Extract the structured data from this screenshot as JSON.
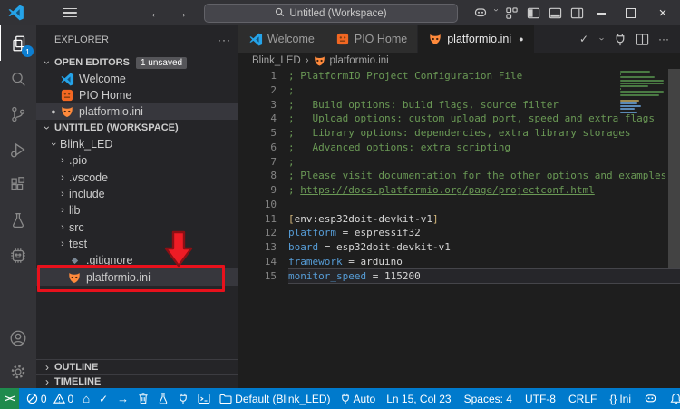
{
  "colors": {
    "status_bar_bg": "#007acc",
    "remote_bg": "#1f8b4d",
    "annotation_red": "#e8111c",
    "pio_orange": "#f26722",
    "vscode_blue": "#25a3e8",
    "badge_blue": "#0d7fd2"
  },
  "glyphs": {
    "back": "←",
    "forward": "→",
    "more": "···",
    "chevron": "›",
    "check": "✓",
    "dirty_dot": "●",
    "modified_dot": "●",
    "home": "⌂",
    "arrow_right": "→",
    "braces": "{}",
    "remote": "><",
    "close": "×"
  },
  "titlebar": {
    "search_text": "Untitled (Workspace)"
  },
  "sidebar": {
    "title": "EXPLORER",
    "open_editors": {
      "label": "OPEN EDITORS",
      "badge": "1 unsaved",
      "items": [
        {
          "label": "Welcome",
          "icon": "vscode-logo-icon",
          "modified": false,
          "selected": false
        },
        {
          "label": "PIO Home",
          "icon": "pio-home-icon",
          "modified": false,
          "selected": false
        },
        {
          "label": "platformio.ini",
          "icon": "platformio-icon",
          "modified": true,
          "selected": true
        }
      ]
    },
    "workspace_label": "UNTITLED (WORKSPACE)",
    "tree": [
      {
        "label": "Blink_LED",
        "depth": 1,
        "type": "folder",
        "expanded": true
      },
      {
        "label": ".pio",
        "depth": 2,
        "type": "folder",
        "expanded": false
      },
      {
        "label": ".vscode",
        "depth": 2,
        "type": "folder",
        "expanded": false
      },
      {
        "label": "include",
        "depth": 2,
        "type": "folder",
        "expanded": false
      },
      {
        "label": "lib",
        "depth": 2,
        "type": "folder",
        "expanded": false
      },
      {
        "label": "src",
        "depth": 2,
        "type": "folder",
        "expanded": false
      },
      {
        "label": "test",
        "depth": 2,
        "type": "folder",
        "expanded": false
      },
      {
        "label": ".gitignore",
        "depth": 2,
        "type": "file",
        "icon": "gitignore-icon",
        "selected": false
      },
      {
        "label": "platformio.ini",
        "depth": 2,
        "type": "file",
        "icon": "platformio-icon",
        "selected": true
      }
    ],
    "outline_label": "OUTLINE",
    "timeline_label": "TIMELINE"
  },
  "tabs": [
    {
      "label": "Welcome",
      "icon": "vscode-logo-icon",
      "active": false,
      "dirty": false
    },
    {
      "label": "PIO Home",
      "icon": "pio-home-icon",
      "active": false,
      "dirty": false
    },
    {
      "label": "platformio.ini",
      "icon": "platformio-icon",
      "active": true,
      "dirty": true
    }
  ],
  "breadcrumb": {
    "folder": "Blink_LED",
    "separator": "›",
    "file": "platformio.ini"
  },
  "editor": {
    "current_line": 15,
    "lines": [
      {
        "num": "1",
        "segments": [
          {
            "text": "; PlatformIO Project Configuration File",
            "type": "comment"
          }
        ]
      },
      {
        "num": "2",
        "segments": [
          {
            "text": ";",
            "type": "comment"
          }
        ]
      },
      {
        "num": "3",
        "segments": [
          {
            "text": ";   Build options: build flags, source filter",
            "type": "comment"
          }
        ]
      },
      {
        "num": "4",
        "segments": [
          {
            "text": ";   Upload options: custom upload port, speed and extra flags",
            "type": "comment"
          }
        ]
      },
      {
        "num": "5",
        "segments": [
          {
            "text": ";   Library options: dependencies, extra library storages",
            "type": "comment"
          }
        ]
      },
      {
        "num": "6",
        "segments": [
          {
            "text": ";   Advanced options: extra scripting",
            "type": "comment"
          }
        ]
      },
      {
        "num": "7",
        "segments": [
          {
            "text": ";",
            "type": "comment"
          }
        ]
      },
      {
        "num": "8",
        "segments": [
          {
            "text": "; Please visit documentation for the other options and examples",
            "type": "comment"
          }
        ]
      },
      {
        "num": "9",
        "segments": [
          {
            "text": "; ",
            "type": "comment"
          },
          {
            "text": "https://docs.platformio.org/page/projectconf.html",
            "type": "link"
          }
        ]
      },
      {
        "num": "10",
        "segments": []
      },
      {
        "num": "11",
        "segments": [
          {
            "text": "[",
            "type": "bracket"
          },
          {
            "text": "env:esp32doit-devkit-v1",
            "type": "section"
          },
          {
            "text": "]",
            "type": "bracket"
          }
        ]
      },
      {
        "num": "12",
        "segments": [
          {
            "text": "platform",
            "type": "key"
          },
          {
            "text": " = ",
            "type": "plain"
          },
          {
            "text": "espressif32",
            "type": "plain"
          }
        ]
      },
      {
        "num": "13",
        "segments": [
          {
            "text": "board",
            "type": "key"
          },
          {
            "text": " = ",
            "type": "plain"
          },
          {
            "text": "esp32doit-devkit-v1",
            "type": "plain"
          }
        ]
      },
      {
        "num": "14",
        "segments": [
          {
            "text": "framework",
            "type": "key"
          },
          {
            "text": " = ",
            "type": "plain"
          },
          {
            "text": "arduino",
            "type": "plain"
          }
        ]
      },
      {
        "num": "15",
        "segments": [
          {
            "text": "monitor_speed",
            "type": "key"
          },
          {
            "text": " = ",
            "type": "plain"
          },
          {
            "text": "115200",
            "type": "plain"
          }
        ]
      }
    ]
  },
  "status_bar": {
    "errors": "0",
    "warnings": "0",
    "project_env": "Default (Blink_LED)",
    "port": "Auto",
    "cursor": "Ln 15, Col 23",
    "indent": "Spaces: 4",
    "encoding": "UTF-8",
    "eol": "CRLF",
    "language": "Ini"
  }
}
